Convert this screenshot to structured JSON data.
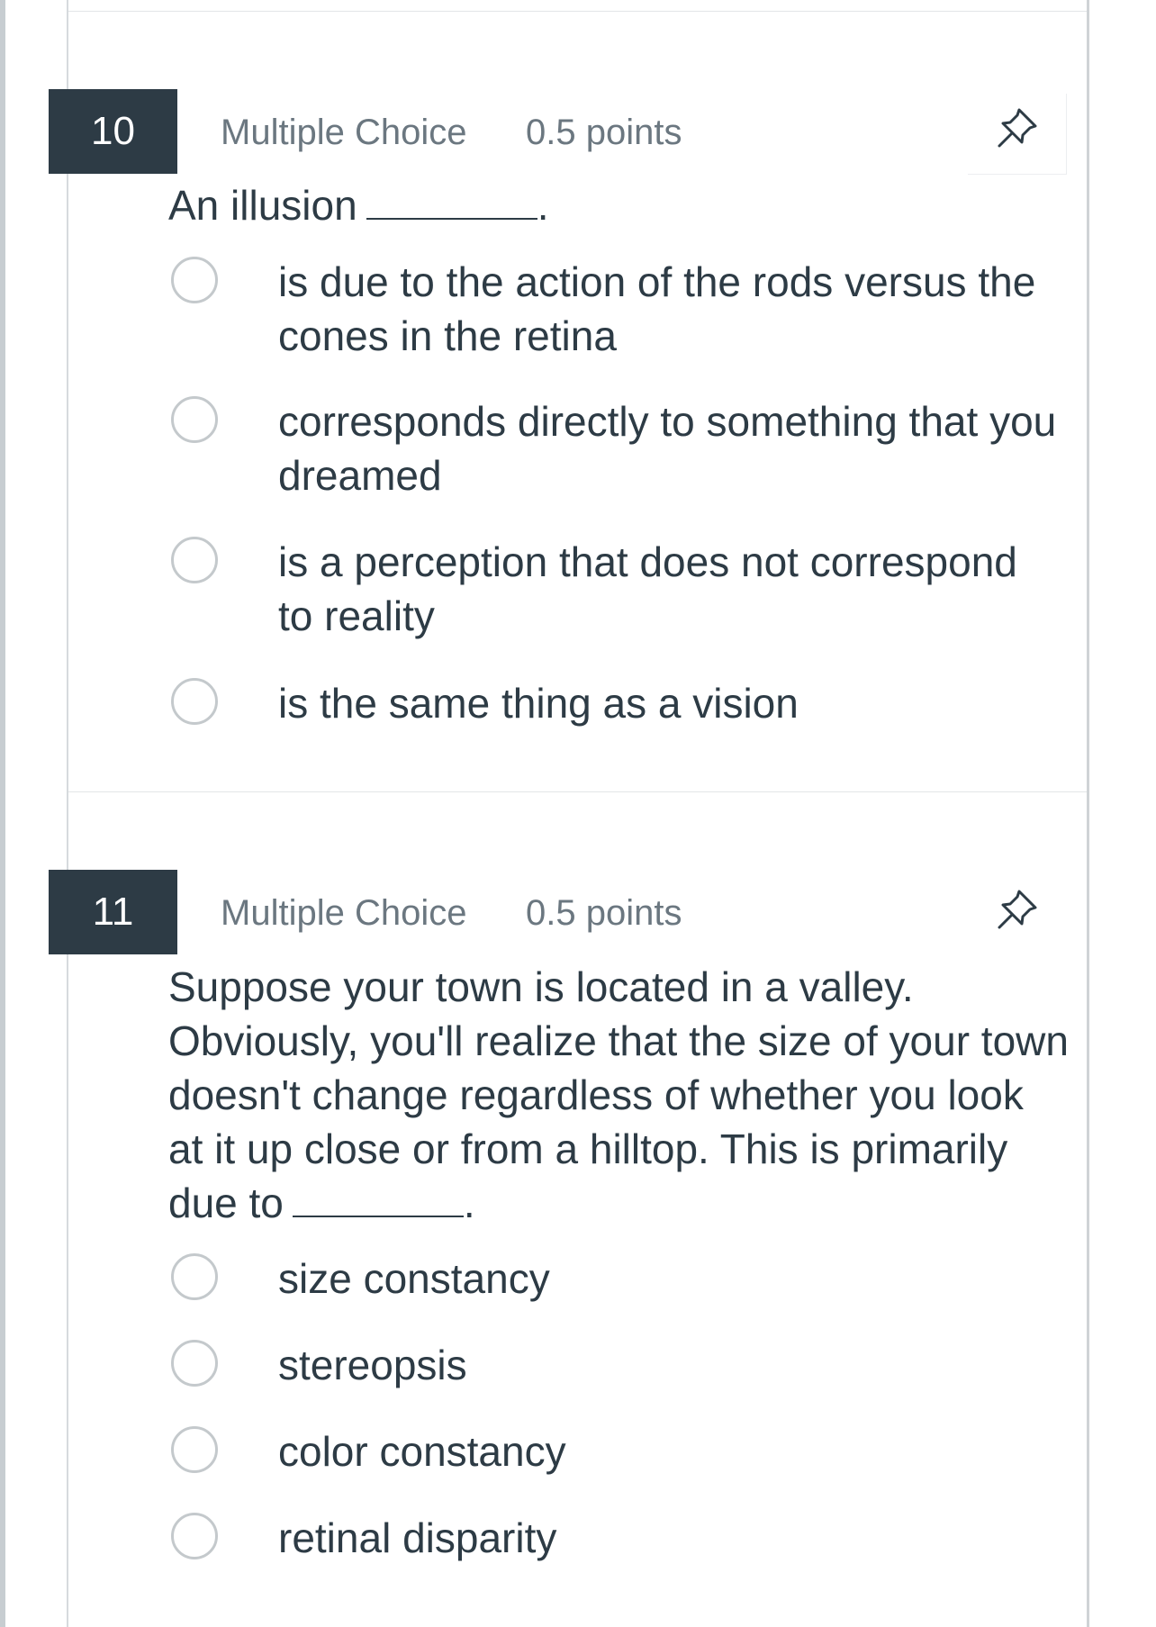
{
  "questions": [
    {
      "number": "10",
      "type": "Multiple Choice",
      "points": "0.5 points",
      "stem": "An illusion",
      "stem_suffix": ".",
      "options": [
        "is due to the action of the rods versus the cones in the retina",
        "corresponds directly to something that you dreamed",
        "is a perception that does not correspond to reality",
        "is the same thing as a vision"
      ]
    },
    {
      "number": "11",
      "type": "Multiple Choice",
      "points": "0.5 points",
      "stem": "Suppose your town is located in a valley. Obviously, you'll realize that the size of your town doesn't change regardless of whether you look at it up close or from a hilltop. This is primarily due to",
      "stem_suffix": ".",
      "options": [
        "size constancy",
        "stereopsis",
        "color constancy",
        "retinal disparity"
      ]
    }
  ],
  "icons": {
    "pin": "pin-icon",
    "radio": "radio-unselected"
  },
  "colors": {
    "number_badge": "#2d3b45",
    "text": "#2d3b45",
    "meta_text": "#6b7780",
    "radio_border": "#c4c9cc"
  }
}
